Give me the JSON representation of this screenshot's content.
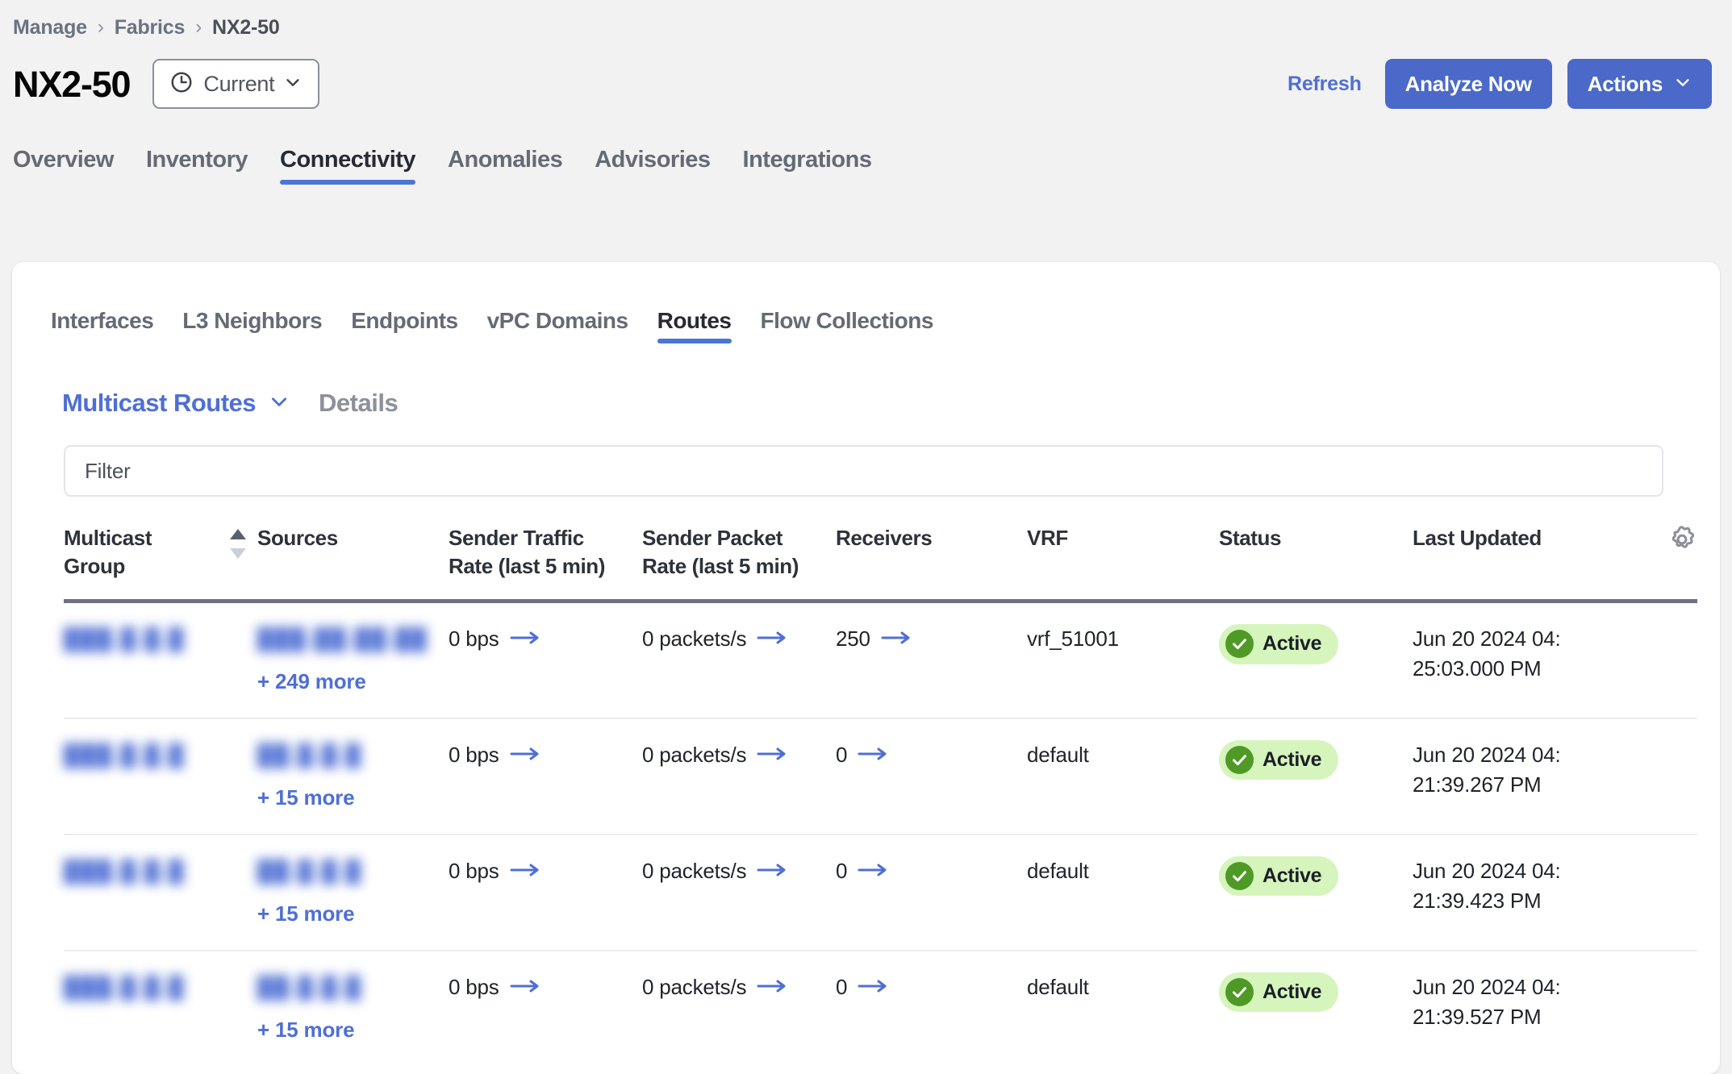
{
  "breadcrumb": {
    "items": [
      "Manage",
      "Fabrics",
      "NX2-50"
    ],
    "separator": "›"
  },
  "header": {
    "title": "NX2-50",
    "time_selector": {
      "label": "Current",
      "icon": "clock-icon",
      "chevron": "chevron-down-icon"
    },
    "refresh_label": "Refresh",
    "analyze_label": "Analyze Now",
    "actions_label": "Actions",
    "primary_color": "#4a69c8",
    "link_color": "#4f6fd4"
  },
  "main_tabs": [
    {
      "label": "Overview",
      "active": false
    },
    {
      "label": "Inventory",
      "active": false
    },
    {
      "label": "Connectivity",
      "active": true
    },
    {
      "label": "Anomalies",
      "active": false
    },
    {
      "label": "Advisories",
      "active": false
    },
    {
      "label": "Integrations",
      "active": false
    }
  ],
  "sub_tabs": [
    {
      "label": "Interfaces",
      "active": false
    },
    {
      "label": "L3 Neighbors",
      "active": false
    },
    {
      "label": "Endpoints",
      "active": false
    },
    {
      "label": "vPC Domains",
      "active": false
    },
    {
      "label": "Routes",
      "active": true
    },
    {
      "label": "Flow Collections",
      "active": false
    }
  ],
  "view": {
    "selected": "Multicast Routes",
    "details_label": "Details"
  },
  "filter": {
    "placeholder": "Filter",
    "value": ""
  },
  "table": {
    "columns": [
      "Multicast Group",
      "Sources",
      "Sender Traffic Rate (last 5 min)",
      "Sender Packet Rate (last 5 min)",
      "Receivers",
      "VRF",
      "Status",
      "Last Updated"
    ],
    "sort": {
      "column": "Multicast Group",
      "direction": "asc"
    },
    "settings_icon": "gear-icon",
    "rows": [
      {
        "group": "███.█.█.█",
        "sources": "███.██.██.██",
        "sources_more": "+ 249 more",
        "traffic_rate": "0 bps",
        "packet_rate": "0 packets/s",
        "receivers": "250",
        "vrf": "vrf_51001",
        "status": "Active",
        "last_updated": "Jun 20 2024 04:\n25:03.000 PM"
      },
      {
        "group": "███.█.█.█",
        "sources": "██.█.█.█",
        "sources_more": "+ 15 more",
        "traffic_rate": "0 bps",
        "packet_rate": "0 packets/s",
        "receivers": "0",
        "vrf": "default",
        "status": "Active",
        "last_updated": "Jun 20 2024 04:\n21:39.267 PM"
      },
      {
        "group": "███.█.█.█",
        "sources": "██.█.█.█",
        "sources_more": "+ 15 more",
        "traffic_rate": "0 bps",
        "packet_rate": "0 packets/s",
        "receivers": "0",
        "vrf": "default",
        "status": "Active",
        "last_updated": "Jun 20 2024 04:\n21:39.423 PM"
      },
      {
        "group": "███.█.█.█",
        "sources": "██.█.█.█",
        "sources_more": "+ 15 more",
        "traffic_rate": "0 bps",
        "packet_rate": "0 packets/s",
        "receivers": "0",
        "vrf": "default",
        "status": "Active",
        "last_updated": "Jun 20 2024 04:\n21:39.527 PM"
      }
    ]
  },
  "colors": {
    "accent_blue": "#4a76d4",
    "link_blue": "#4f6fd4",
    "status_bg": "#d6f5bd",
    "status_fg": "#4f9a26",
    "page_bg": "#f2f2f3"
  }
}
